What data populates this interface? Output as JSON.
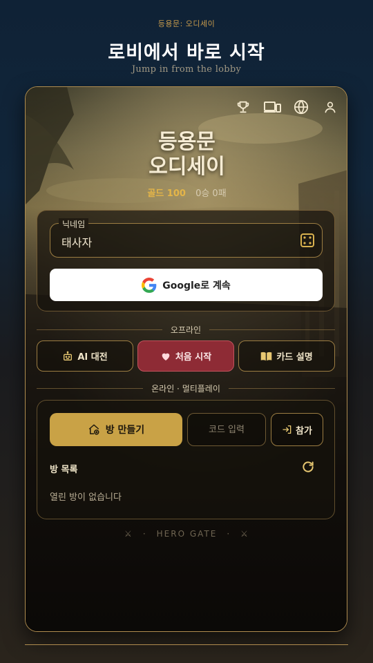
{
  "page": {
    "label": "등용문: 오디세이",
    "heading": "로비에서 바로 시작",
    "subheading": "Jump in from the lobby"
  },
  "top_icons": [
    "trophy-icon",
    "devices-icon",
    "globe-icon",
    "user-icon"
  ],
  "game": {
    "title_line1": "등용문",
    "title_line2": "오디세이",
    "gold": "골드 100",
    "record": "0승 0패"
  },
  "login": {
    "nickname_label": "닉네임",
    "nickname_value": "태사자",
    "google_label": "Google로 계속"
  },
  "offline": {
    "label": "오프라인",
    "buttons": [
      {
        "label": "AI 대전",
        "icon": "robot-icon"
      },
      {
        "label": "처음 시작",
        "icon": "heart-icon"
      },
      {
        "label": "카드 설명",
        "icon": "book-icon"
      }
    ]
  },
  "online": {
    "label": "온라인 · 멀티플레이",
    "create_label": "방 만들기",
    "code_placeholder": "코드 입력",
    "join_label": "참가",
    "room_list_title": "방 목록",
    "empty_text": "열린 방이 없습니다"
  },
  "footer": {
    "ornament": "⚔",
    "dot": "·",
    "text": "HERO GATE"
  },
  "colors": {
    "accent_gold": "#c9a246",
    "primary_red": "#8e2b35",
    "border_gold": "#b08d4f"
  }
}
